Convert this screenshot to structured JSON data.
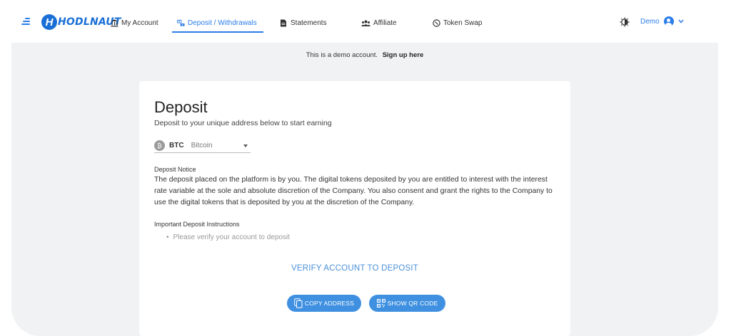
{
  "nav": {
    "logo_text": "HODLNAUT",
    "logo_mark": "H",
    "items": [
      {
        "label": "My Account",
        "icon": "bank-icon"
      },
      {
        "label": "Deposit / Withdrawals",
        "icon": "money-transfer-icon",
        "active": true
      },
      {
        "label": "Statements",
        "icon": "document-icon"
      },
      {
        "label": "Affiliate",
        "icon": "users-icon"
      },
      {
        "label": "Token Swap",
        "icon": "swap-icon"
      }
    ],
    "user_label": "Demo"
  },
  "demo_notice": {
    "text": "This is a demo account.",
    "link": "Sign up here"
  },
  "deposit": {
    "title": "Deposit",
    "subtitle": "Deposit to your unique address below to start earning",
    "coin": {
      "symbol": "₿",
      "code": "BTC",
      "name": "Bitcoin"
    },
    "notice_title": "Deposit Notice",
    "notice_body": "The deposit placed on the platform is by you. The digital tokens deposited by you are entitled to interest with the interest rate variable at the sole and absolute discretion of the Company. You also consent and grant the rights to the Company to use the digital tokens that is deposited by you at the discretion of the Company.",
    "instructions_title": "Important Deposit Instructions",
    "instructions": [
      "Please verify your account to deposit"
    ],
    "verify_link": "VERIFY ACCOUNT TO DEPOSIT",
    "copy_button": "COPY ADDRESS",
    "qr_button": "SHOW QR CODE"
  },
  "colors": {
    "accent": "#2b7de9",
    "button": "#3f90e0",
    "background": "#f1f2f4"
  }
}
